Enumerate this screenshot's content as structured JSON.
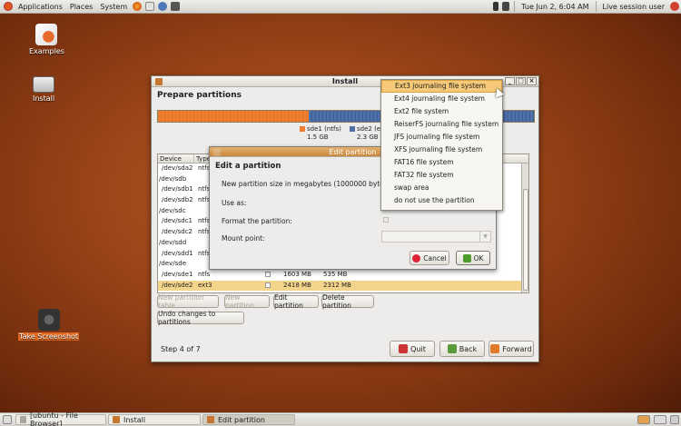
{
  "top_panel": {
    "menus": [
      "Applications",
      "Places",
      "System"
    ],
    "datetime": "Tue Jun  2,  6:04 AM",
    "user": "Live session user"
  },
  "desktop": {
    "icons": [
      "Examples",
      "Install",
      "Take Screenshot"
    ]
  },
  "install_window": {
    "title": "Install",
    "heading": "Prepare partitions",
    "legend": [
      {
        "name": "sde1 (ntfs)",
        "size": "1.5 GB",
        "color": "#f08030"
      },
      {
        "name": "sde2 (e",
        "size": "2.3 GB",
        "color": "#4f6fa8"
      }
    ],
    "table": {
      "headers": [
        "Device",
        "Type"
      ],
      "rows": [
        {
          "device": "/dev/sda2",
          "type": "ntfs",
          "size": "",
          "used": ""
        },
        {
          "device": "/dev/sdb",
          "type": "",
          "size": "",
          "used": ""
        },
        {
          "device": "/dev/sdb1",
          "type": "ntfs",
          "size": "",
          "used": ""
        },
        {
          "device": "/dev/sdb2",
          "type": "ntfs",
          "size": "",
          "used": ""
        },
        {
          "device": "/dev/sdc",
          "type": "",
          "size": "",
          "used": ""
        },
        {
          "device": "/dev/sdc1",
          "type": "ntfs",
          "size": "",
          "used": ""
        },
        {
          "device": "/dev/sdc2",
          "type": "ntfs",
          "size": "",
          "used": ""
        },
        {
          "device": "/dev/sdd",
          "type": "",
          "size": "",
          "used": ""
        },
        {
          "device": "/dev/sdd1",
          "type": "ntfs",
          "size": "",
          "used": ""
        },
        {
          "device": "/dev/sde",
          "type": "",
          "size": "",
          "used": ""
        },
        {
          "device": "/dev/sde1",
          "type": "ntfs",
          "size": "1603 MB",
          "used": "535 MB"
        },
        {
          "device": "/dev/sde2",
          "type": "ext3",
          "size": "2418 MB",
          "used": "2312 MB"
        }
      ]
    },
    "buttons": {
      "new_table": "New partition table",
      "new_partition": "New partition",
      "edit_partition": "Edit partition",
      "delete_partition": "Delete partition",
      "undo": "Undo changes to partitions",
      "quit": "Quit",
      "back": "Back",
      "forward": "Forward"
    },
    "step": "Step 4 of 7"
  },
  "edit_dialog": {
    "title": "Edit partition",
    "heading": "Edit a partition",
    "labels": {
      "size": "New partition size in megabytes (1000000 bytes):",
      "use_as": "Use as:",
      "format": "Format the partition:",
      "mount": "Mount point:"
    },
    "cancel": "Cancel",
    "ok": "OK"
  },
  "use_as_menu": {
    "options": [
      "Ext3 journaling file system",
      "Ext4 journaling file system",
      "Ext2 file system",
      "ReiserFS journaling file system",
      "JFS journaling file system",
      "XFS journaling file system",
      "FAT16 file system",
      "FAT32 file system",
      "swap area",
      "do not use the partition"
    ],
    "highlighted": "Ext3 journaling file system"
  },
  "taskbar": {
    "items": [
      "[ubuntu - File Browser]",
      "Install",
      "Edit partition"
    ]
  }
}
